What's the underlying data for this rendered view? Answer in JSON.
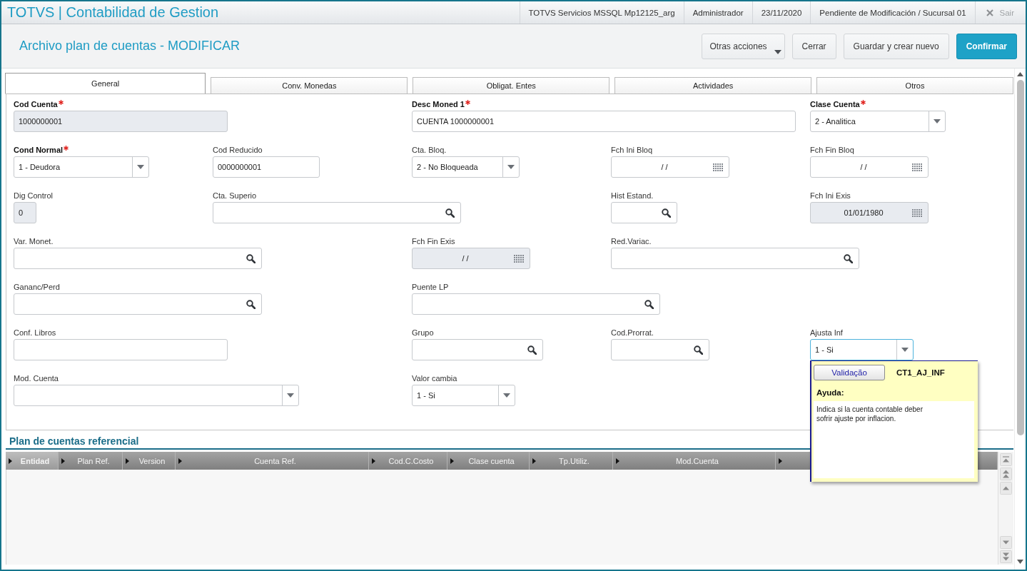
{
  "app": {
    "title": "TOTVS | Contabilidad de Gestion",
    "info": [
      "TOTVS Servicios MSSQL Mp12125_arg",
      "Administrador",
      "23/11/2020",
      "Pendiente de Modificación / Sucursal 01"
    ],
    "exit_button": "Sair"
  },
  "toolbar": {
    "title": "Archivo plan de cuentas - MODIFICAR",
    "buttons": [
      {
        "label": "Otras acciones",
        "kind": "menu"
      },
      {
        "label": "Cerrar",
        "kind": "default"
      },
      {
        "label": "Guardar y crear nuevo",
        "kind": "default"
      },
      {
        "label": "Confirmar",
        "kind": "primary"
      }
    ]
  },
  "tabs": [
    {
      "label": "General",
      "selected": true
    },
    {
      "label": "Conv. Monedas",
      "selected": false
    },
    {
      "label": "Obligat. Entes",
      "selected": false
    },
    {
      "label": "Actividades",
      "selected": false
    },
    {
      "label": "Otros",
      "selected": false
    }
  ],
  "form": {
    "rows": [
      {
        "fields": [
          {
            "label": "Cod Cuenta",
            "kind": "text",
            "value": "1000000001",
            "required": true,
            "disabled": true,
            "focused": false
          },
          {
            "label": "Desc Moned 1",
            "kind": "text",
            "value": "CUENTA 1000000001",
            "required": true,
            "disabled": false,
            "focused": false
          },
          {
            "label": "Clase Cuenta",
            "kind": "select",
            "value": "2 - Analitica",
            "required": true,
            "disabled": false,
            "focused": false
          }
        ]
      },
      {
        "fields": [
          {
            "label": "Cond Normal",
            "kind": "select",
            "value": "1 - Deudora",
            "required": true,
            "disabled": false,
            "focused": false
          },
          {
            "label": "Cod Reducido",
            "kind": "text",
            "value": "0000000001",
            "required": false,
            "disabled": false,
            "focused": false
          },
          {
            "label": "Cta. Bloq.",
            "kind": "select",
            "value": "2 - No Bloqueada",
            "required": false,
            "disabled": false,
            "focused": false
          },
          {
            "label": "Fch Ini Bloq",
            "kind": "date",
            "value": "/ /",
            "required": false,
            "disabled": false,
            "focused": false
          },
          {
            "label": "Fch Fin Bloq",
            "kind": "date",
            "value": "/ /",
            "required": false,
            "disabled": false,
            "focused": false
          }
        ]
      },
      {
        "fields": [
          {
            "label": "Dig Control",
            "kind": "text",
            "value": "0",
            "required": false,
            "disabled": true,
            "focused": false
          },
          {
            "label": "Cta. Superio",
            "kind": "search",
            "required": false,
            "disabled": false,
            "focused": false
          },
          {
            "label": "Hist Estand.",
            "kind": "search",
            "required": false,
            "disabled": false,
            "focused": false
          },
          {
            "label": "Fch Ini Exis",
            "kind": "date",
            "value": "01/01/1980",
            "required": false,
            "disabled": true,
            "focused": false
          }
        ]
      },
      {
        "fields": [
          {
            "label": "Var. Monet.",
            "kind": "search",
            "required": false,
            "disabled": false,
            "focused": false
          },
          {
            "label": "Fch Fin Exis",
            "kind": "date",
            "value": "/ /",
            "required": false,
            "disabled": true,
            "focused": false
          },
          {
            "label": "Red.Variac.",
            "kind": "search",
            "required": false,
            "disabled": false,
            "focused": false
          }
        ]
      },
      {
        "fields": [
          {
            "label": "Gananc/Perd",
            "kind": "search",
            "required": false,
            "disabled": false,
            "focused": false
          },
          {
            "label": "Puente LP",
            "kind": "search",
            "required": false,
            "disabled": false,
            "focused": false
          }
        ]
      },
      {
        "fields": [
          {
            "label": "Conf. Libros",
            "kind": "text",
            "required": false,
            "disabled": false,
            "focused": false
          },
          {
            "label": "Grupo",
            "kind": "search",
            "required": false,
            "disabled": false,
            "focused": false
          },
          {
            "label": "Cod.Prorrat.",
            "kind": "search",
            "required": false,
            "disabled": false,
            "focused": false
          },
          {
            "label": "Ajusta Inf",
            "kind": "select",
            "value": "1 - Si",
            "required": false,
            "disabled": false,
            "focused": true,
            "help": {
              "button": "Validação",
              "field_code": "CT1_AJ_INF",
              "heading": "Ayuda:",
              "text": "Indica si la cuenta contable deber\nsofrir ajuste por inflacion."
            }
          }
        ]
      },
      {
        "fields": [
          {
            "label": "Mod. Cuenta",
            "kind": "select",
            "required": false,
            "disabled": false,
            "focused": false
          },
          {
            "label": "Valor cambia",
            "kind": "select",
            "value": "1 - Si",
            "required": false,
            "disabled": false,
            "focused": false
          }
        ]
      }
    ]
  },
  "reference_section": {
    "title": "Plan de cuentas referencial",
    "columns": [
      {
        "label": "Entidad",
        "selected": true
      },
      {
        "label": "Plan Ref.",
        "selected": false
      },
      {
        "label": "Version",
        "selected": false
      },
      {
        "label": "Cuenta Ref.",
        "selected": false
      },
      {
        "label": "Cod.C.Costo",
        "selected": false
      },
      {
        "label": "Clase cuenta",
        "selected": false
      },
      {
        "label": "Tp.Utiliz.",
        "selected": false
      },
      {
        "label": "Mod.Cuenta",
        "selected": false
      },
      {
        "selected": false
      }
    ]
  }
}
